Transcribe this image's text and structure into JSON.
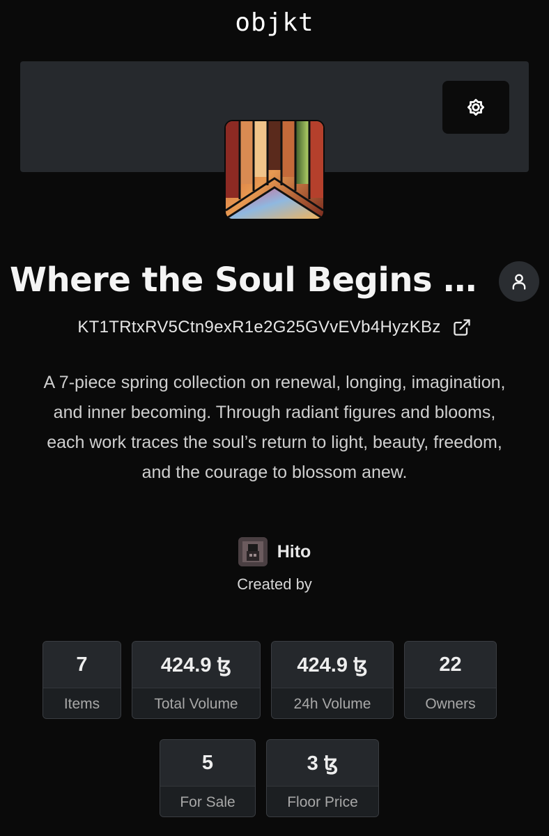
{
  "header": {
    "logo": "objkt"
  },
  "banner": {
    "settings_icon": "gear-icon"
  },
  "collection": {
    "title": "Where the Soul Begins to…",
    "address": "KT1TRtxRV5Ctn9exR1e2G25GVvEVb4HyzKBz",
    "description": "A 7-piece spring collection on renewal, longing, imagination, and inner becoming. Through radiant figures and blooms, each work traces the soul’s return to light, beauty, freedom, and the courage to blossom anew.",
    "creator_name": "Hito",
    "created_by_label": "Created by"
  },
  "stats": [
    {
      "value": "7",
      "label": "Items"
    },
    {
      "value": "424.9 ꜩ",
      "label": "Total Volume"
    },
    {
      "value": "424.9 ꜩ",
      "label": "24h Volume"
    },
    {
      "value": "22",
      "label": "Owners"
    },
    {
      "value": "5",
      "label": "For Sale"
    },
    {
      "value": "3 ꜩ",
      "label": "Floor Price"
    }
  ],
  "colors": {
    "background": "#0a0a0a",
    "banner": "#26292d",
    "stat_box": "#25282c"
  }
}
